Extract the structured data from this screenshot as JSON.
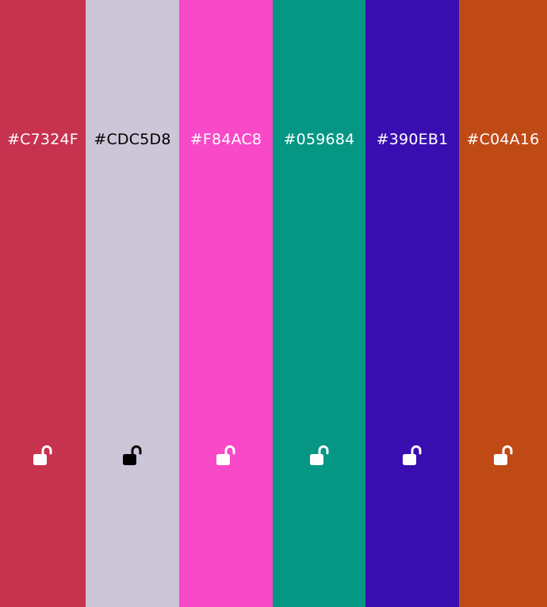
{
  "palette": {
    "swatches": [
      {
        "hex": "#C7324F",
        "color": "#C7324F",
        "text_color": "#FFFFFF",
        "lock_state": "unlocked",
        "lock_icon": "unlock-icon"
      },
      {
        "hex": "#CDC5D8",
        "color": "#CDC5D8",
        "text_color": "#000000",
        "lock_state": "unlocked",
        "lock_icon": "unlock-icon"
      },
      {
        "hex": "#F84AC8",
        "color": "#F84AC8",
        "text_color": "#FFFFFF",
        "lock_state": "unlocked",
        "lock_icon": "unlock-icon"
      },
      {
        "hex": "#059684",
        "color": "#059684",
        "text_color": "#FFFFFF",
        "lock_state": "unlocked",
        "lock_icon": "unlock-icon"
      },
      {
        "hex": "#390EB1",
        "color": "#390EB1",
        "text_color": "#FFFFFF",
        "lock_state": "unlocked",
        "lock_icon": "unlock-icon"
      },
      {
        "hex": "#C04A16",
        "color": "#C04A16",
        "text_color": "#FFFFFF",
        "lock_state": "unlocked",
        "lock_icon": "unlock-icon"
      }
    ]
  }
}
